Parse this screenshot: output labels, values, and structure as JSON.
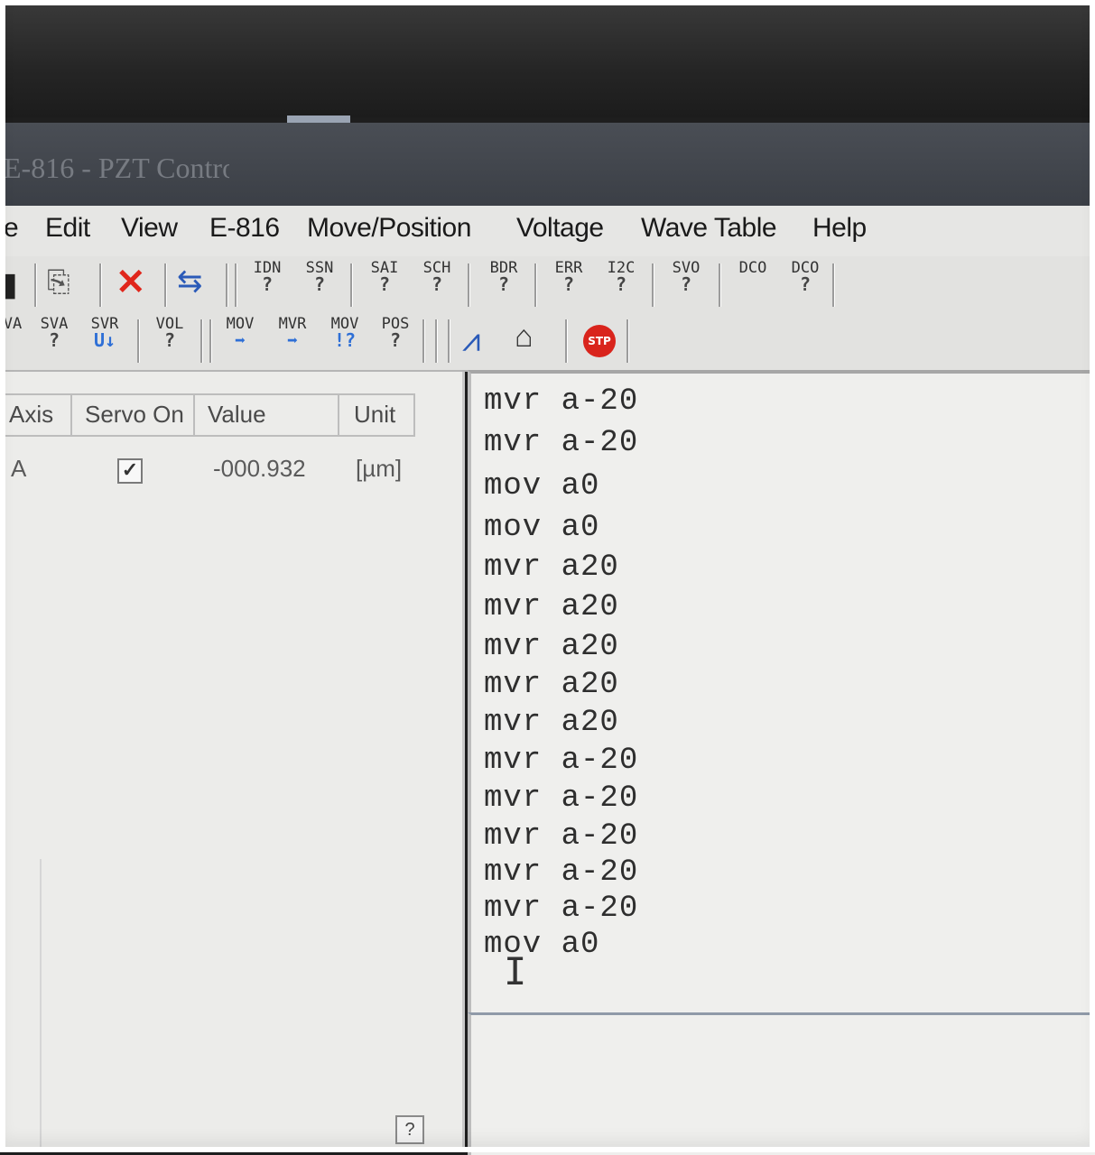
{
  "window": {
    "title": "E-816 - PZT Contro"
  },
  "menu": {
    "items": [
      "e",
      "Edit",
      "View",
      "E-816",
      "Move/Position",
      "Voltage",
      "Wave Table",
      "Help"
    ]
  },
  "toolbar1": {
    "buttons": [
      {
        "label": "IDN",
        "sub": "?"
      },
      {
        "label": "SSN",
        "sub": "?"
      },
      {
        "label": "SAI",
        "sub": "?"
      },
      {
        "label": "SCH",
        "sub": "?"
      },
      {
        "label": "BDR",
        "sub": "?"
      },
      {
        "label": "ERR",
        "sub": "?"
      },
      {
        "label": "I2C",
        "sub": "?"
      },
      {
        "label": "SVO",
        "sub": "?"
      },
      {
        "label": "DCO",
        "sub": ""
      },
      {
        "label": "DCO",
        "sub": "?"
      }
    ]
  },
  "toolbar2": {
    "buttons": [
      {
        "label": "VA",
        "sub": ""
      },
      {
        "label": "SVA",
        "sub": "?"
      },
      {
        "label": "SVR",
        "sub": "U↓"
      },
      {
        "label": "VOL",
        "sub": "?"
      },
      {
        "label": "MOV",
        "sub": "➡"
      },
      {
        "label": "MVR",
        "sub": "➡"
      },
      {
        "label": "MOV",
        "sub": "!?"
      },
      {
        "label": "POS",
        "sub": "?"
      }
    ],
    "stop_label": "STP"
  },
  "axis_grid": {
    "headers": [
      "Axis",
      "Servo On",
      "Value",
      "Unit"
    ],
    "rows": [
      {
        "axis": "A",
        "servo_on": true,
        "value": "-000.932",
        "unit": "[µm]"
      }
    ]
  },
  "console": {
    "lines": [
      "mvr a-20",
      "mvr a-20",
      "mov a0",
      "mov a0",
      "mvr a20",
      "mvr a20",
      "mvr a20",
      "mvr a20",
      "mvr a20",
      "mvr a-20",
      "mvr a-20",
      "mvr a-20",
      "mvr a-20",
      "mvr a-20",
      "mov a0"
    ]
  },
  "icons": {
    "save": "save-icon",
    "copy": "copy-icon",
    "delete": "delete-x-icon",
    "connect": "connect-arrows-icon",
    "plot": "chart-icon",
    "export": "export-icon",
    "stop": "stop-icon",
    "help": "help-icon"
  }
}
